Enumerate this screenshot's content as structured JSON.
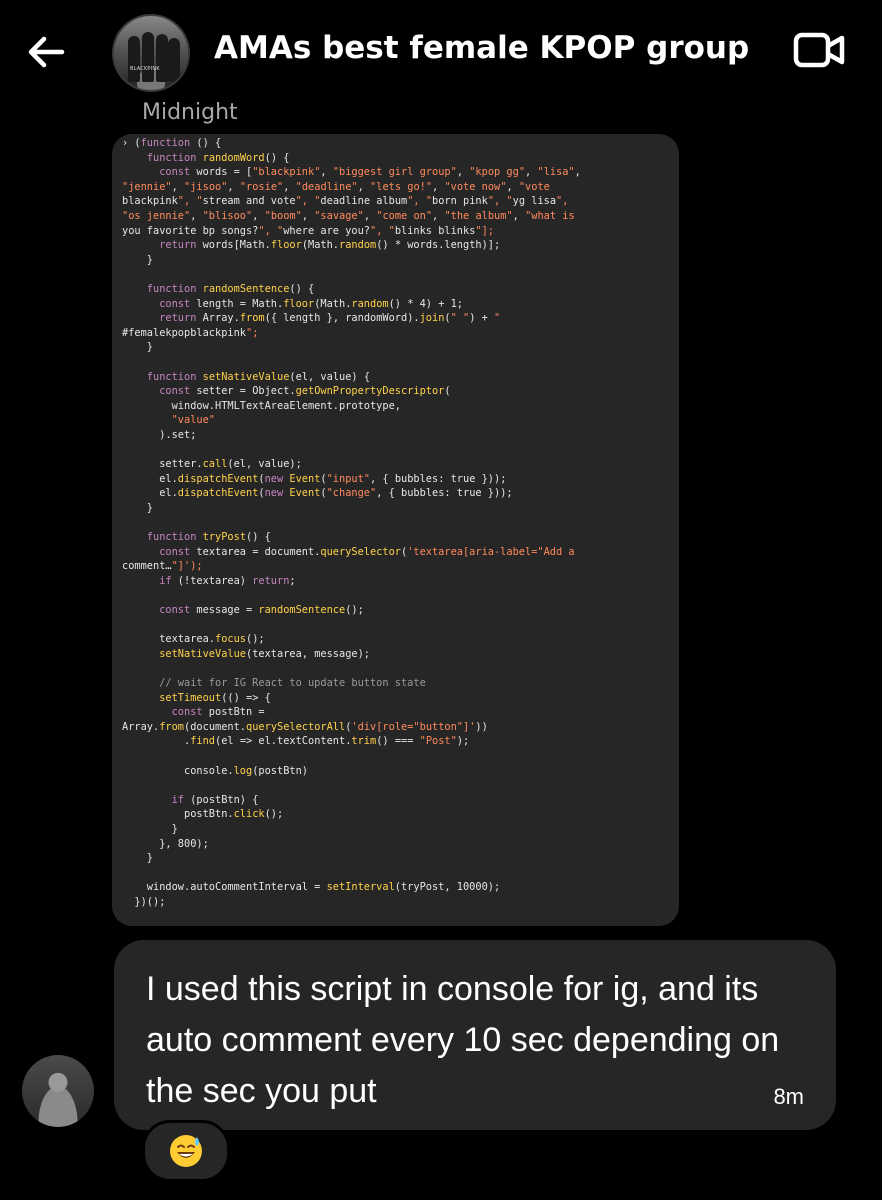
{
  "header": {
    "title": "AMAs best female KPOP group",
    "back_icon": "arrow-left-icon",
    "video_icon": "video-call-icon",
    "avatar_logo_text": "BLACKPINK"
  },
  "message": {
    "sender_label": "Midnight",
    "code_lines": [
      "› (function () {",
      "    function randomWord() {",
      "      const words = [\"blackpink\", \"biggest girl group\", \"kpop gg\", \"lisa\",",
      "\"jennie\", \"jisoo\", \"rosie\", \"deadline\", \"lets go!\", \"vote now\", \"vote",
      "blackpink\", \"stream and vote\", \"deadline album\", \"born pink\", \"yg lisa\",",
      "\"os jennie\", \"blisoo\", \"boom\", \"savage\", \"come on\", \"the album\", \"what is",
      "you favorite bp songs?\", \"where are you?\", \"blinks blinks\"];",
      "      return words[Math.floor(Math.random() * words.length)];",
      "    }",
      "",
      "    function randomSentence() {",
      "      const length = Math.floor(Math.random() * 4) + 1;",
      "      return Array.from({ length }, randomWord).join(\" \") + \"",
      "#femalekpopblackpink\";",
      "    }",
      "",
      "    function setNativeValue(el, value) {",
      "      const setter = Object.getOwnPropertyDescriptor(",
      "        window.HTMLTextAreaElement.prototype,",
      "        \"value\"",
      "      ).set;",
      "",
      "      setter.call(el, value);",
      "      el.dispatchEvent(new Event(\"input\", { bubbles: true }));",
      "      el.dispatchEvent(new Event(\"change\", { bubbles: true }));",
      "    }",
      "",
      "    function tryPost() {",
      "      const textarea = document.querySelector('textarea[aria-label=\"Add a",
      "comment…\"]');",
      "      if (!textarea) return;",
      "",
      "      const message = randomSentence();",
      "",
      "      textarea.focus();",
      "      setNativeValue(textarea, message);",
      "",
      "      // wait for IG React to update button state",
      "      setTimeout(() => {",
      "        const postBtn =",
      "Array.from(document.querySelectorAll('div[role=\"button\"]'))",
      "          .find(el => el.textContent.trim() === \"Post\");",
      "",
      "          console.log(postBtn)",
      "",
      "        if (postBtn) {",
      "          postBtn.click();",
      "        }",
      "      }, 800);",
      "    }",
      "",
      "    window.autoCommentInterval = setInterval(tryPost, 10000);",
      "  })();"
    ],
    "reply_text": "I used this script in console for ig, and its auto comment every 10 sec depending on the sec you put",
    "time": "8m",
    "reaction_icon": "sweat-smile-emoji-icon"
  },
  "colors": {
    "background": "#000000",
    "bubble": "#262626",
    "keyword": "#c586c0",
    "function": "#ffd24a",
    "string": "#ff8a5c",
    "comment": "#9a9a9a"
  }
}
